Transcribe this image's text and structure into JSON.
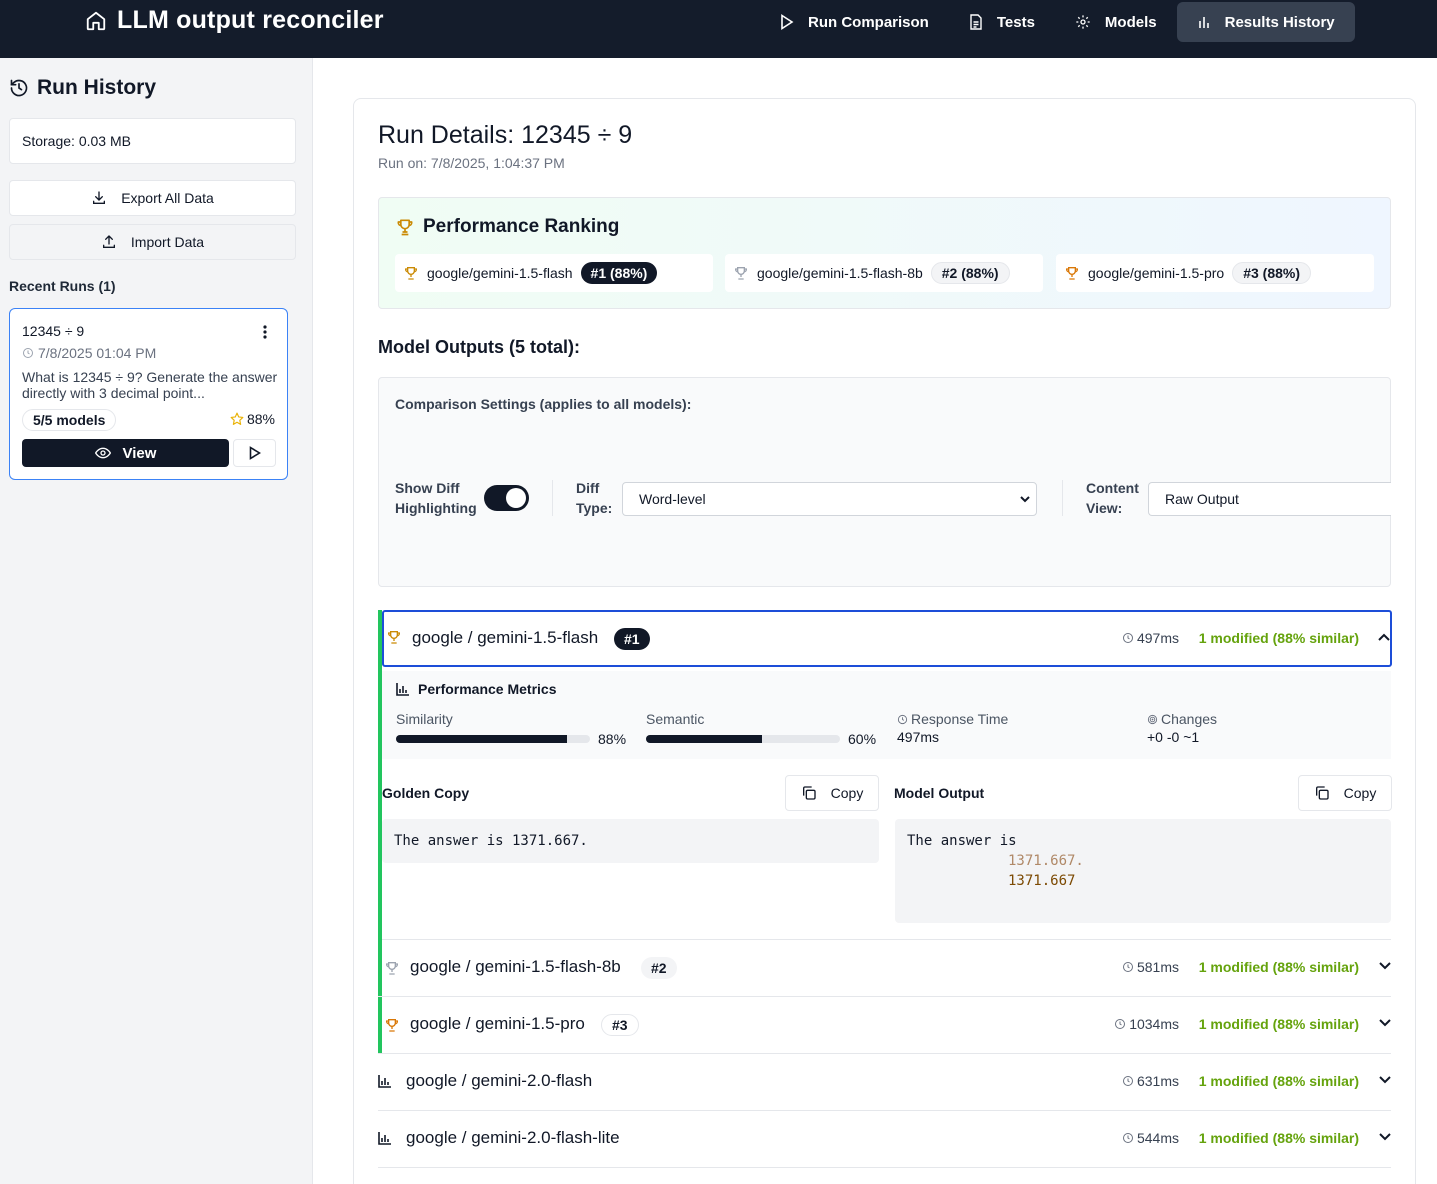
{
  "app": {
    "title": "LLM output reconciler",
    "nav": [
      {
        "label": "Run Comparison",
        "icon": "play-icon"
      },
      {
        "label": "Tests",
        "icon": "document-icon"
      },
      {
        "label": "Models",
        "icon": "gear-icon"
      },
      {
        "label": "Results History",
        "icon": "bar-chart-icon",
        "active": true
      }
    ]
  },
  "sidebar": {
    "title": "Run History",
    "storage": "Storage: 0.03 MB",
    "export_label": "Export All Data",
    "import_label": "Import Data",
    "recent_label": "Recent Runs (1)",
    "run": {
      "title": "12345 ÷ 9",
      "date": "7/8/2025 01:04 PM",
      "description": "What is 12345 ÷ 9? Generate the answer directly with 3 decimal point...",
      "models_badge": "5/5 models",
      "score": "88%",
      "view_label": "View"
    }
  },
  "details": {
    "title": "Run Details: 12345 ÷ 9",
    "run_on": "Run on: 7/8/2025, 1:04:37 PM",
    "ranking_title": "Performance Ranking",
    "ranking": [
      {
        "model": "google/gemini-1.5-flash",
        "rank": "#1 (88%)"
      },
      {
        "model": "google/gemini-1.5-flash-8b",
        "rank": "#2 (88%)"
      },
      {
        "model": "google/gemini-1.5-pro",
        "rank": "#3 (88%)"
      }
    ],
    "outputs_heading": "Model Outputs (5 total):",
    "settings": {
      "title": "Comparison Settings (applies to all models):",
      "diff_toggle_label": "Show Diff Highlighting",
      "diff_toggle_on": true,
      "diff_type_label": "Diff Type:",
      "diff_type_value": "Word-level",
      "content_view_label": "Content View:",
      "content_view_value": "Raw Output"
    },
    "models": [
      {
        "name": "google / gemini-1.5-flash",
        "rank": "#1",
        "time": "497ms",
        "similarity": "1 modified (88% similar)",
        "expanded": true
      },
      {
        "name": "google / gemini-1.5-flash-8b",
        "rank": "#2",
        "time": "581ms",
        "similarity": "1 modified (88% similar)"
      },
      {
        "name": "google / gemini-1.5-pro",
        "rank": "#3",
        "time": "1034ms",
        "similarity": "1 modified (88% similar)"
      },
      {
        "name": "google / gemini-2.0-flash",
        "rank": "",
        "time": "631ms",
        "similarity": "1 modified (88% similar)"
      },
      {
        "name": "google / gemini-2.0-flash-lite",
        "rank": "",
        "time": "544ms",
        "similarity": "1 modified (88% similar)"
      }
    ],
    "metrics": {
      "title": "Performance Metrics",
      "similarity_label": "Similarity",
      "similarity_value": "88%",
      "similarity_fraction": 0.88,
      "semantic_label": "Semantic",
      "semantic_value": "60%",
      "semantic_fraction": 0.6,
      "response_label": "Response Time",
      "response_value": "497ms",
      "changes_label": "Changes",
      "changes_value": "+0 -0 ~1"
    },
    "golden": {
      "label": "Golden Copy",
      "copy_label": "Copy",
      "text": "The answer is 1371.667."
    },
    "output": {
      "label": "Model Output",
      "copy_label": "Copy",
      "prefix": "The answer is",
      "removed": "1371.667.",
      "added": "1371.667"
    }
  }
}
